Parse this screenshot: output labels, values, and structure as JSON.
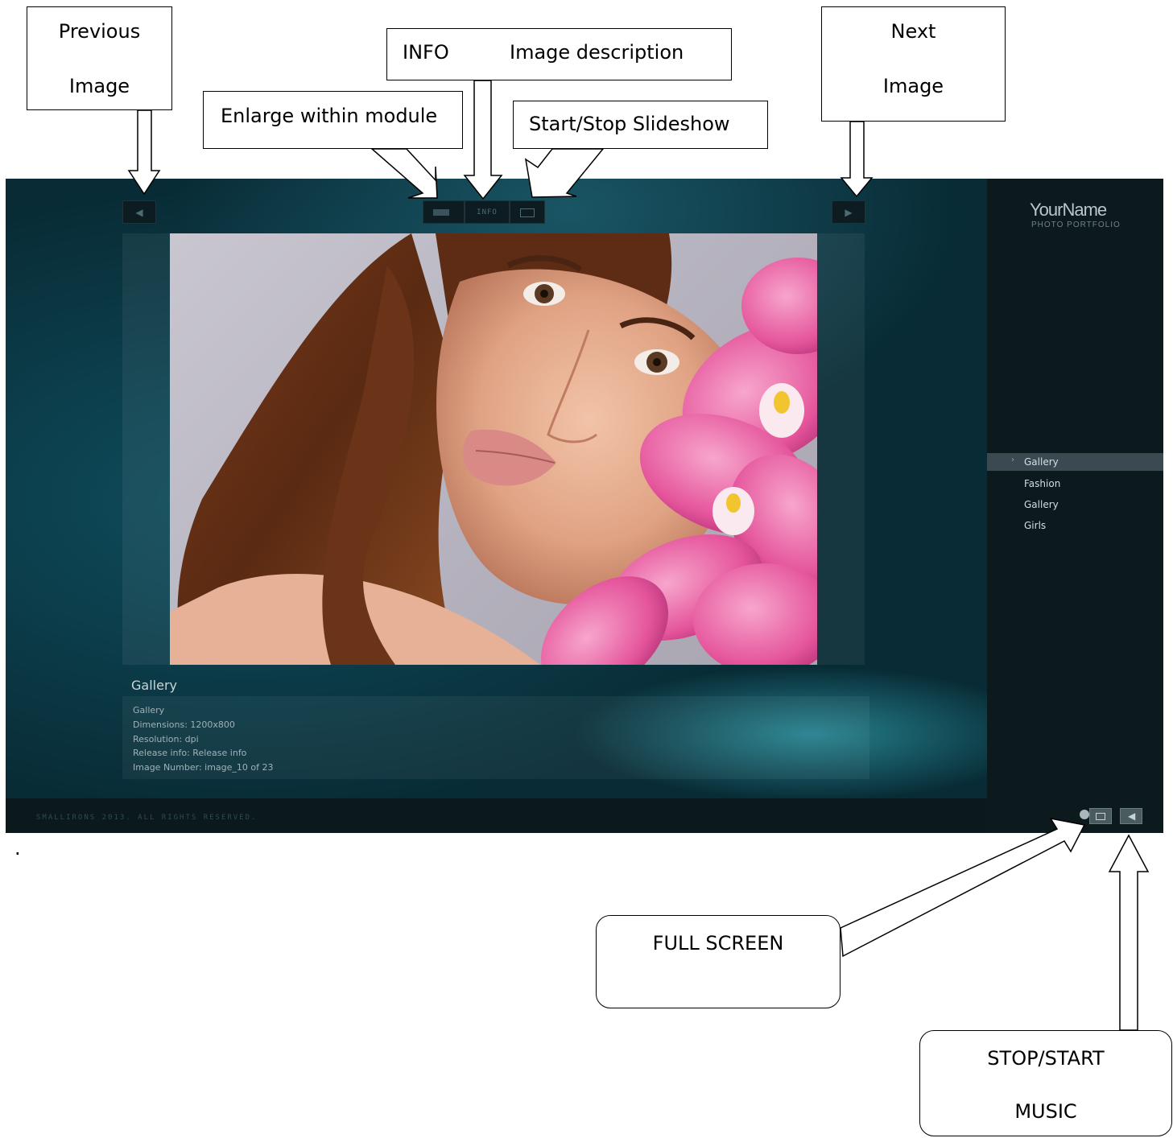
{
  "callouts": {
    "previous": {
      "line1": "Previous",
      "line2": "Image"
    },
    "info": {
      "label": "INFO",
      "desc": "Image description"
    },
    "enlarge": {
      "label": "Enlarge within module"
    },
    "slideshow": {
      "label": "Start/Stop Slideshow"
    },
    "next": {
      "line1": "Next",
      "line2": "Image"
    },
    "fullscreen": {
      "label": "FULL SCREEN"
    },
    "music": {
      "line1": "STOP/START",
      "line2": "MUSIC"
    }
  },
  "stray_mark": ".",
  "app": {
    "info_button_label": "INFO",
    "brand": {
      "name": "YourName",
      "subtitle": "PHOTO PORTFOLIO"
    },
    "menu": [
      {
        "label": "Gallery",
        "active": true
      },
      {
        "label": "Fashion",
        "active": false
      },
      {
        "label": "Gallery",
        "active": false
      },
      {
        "label": "Girls",
        "active": false
      }
    ],
    "gallery_title": "Gallery",
    "info": {
      "title": "Gallery",
      "dimensions": "Dimensions:  1200x800",
      "resolution": "Resolution:  dpi",
      "release": "Release info:  Release info",
      "image_number": "Image Number:   image_10 of 23"
    },
    "footer_text": "SMALLIRONS 2013. ALL RIGHTS RESERVED."
  },
  "colors": {
    "background_teal": "#0f4e5e",
    "sidebar": "#0c191d",
    "menu_active": "#3a4a50",
    "flower_pink": "#e5559c"
  },
  "icons": [
    "chevron-left-icon",
    "chevron-right-icon",
    "enlarge-icon",
    "slideshow-icon",
    "fullscreen-icon",
    "music-icon",
    "arrow-icon"
  ]
}
